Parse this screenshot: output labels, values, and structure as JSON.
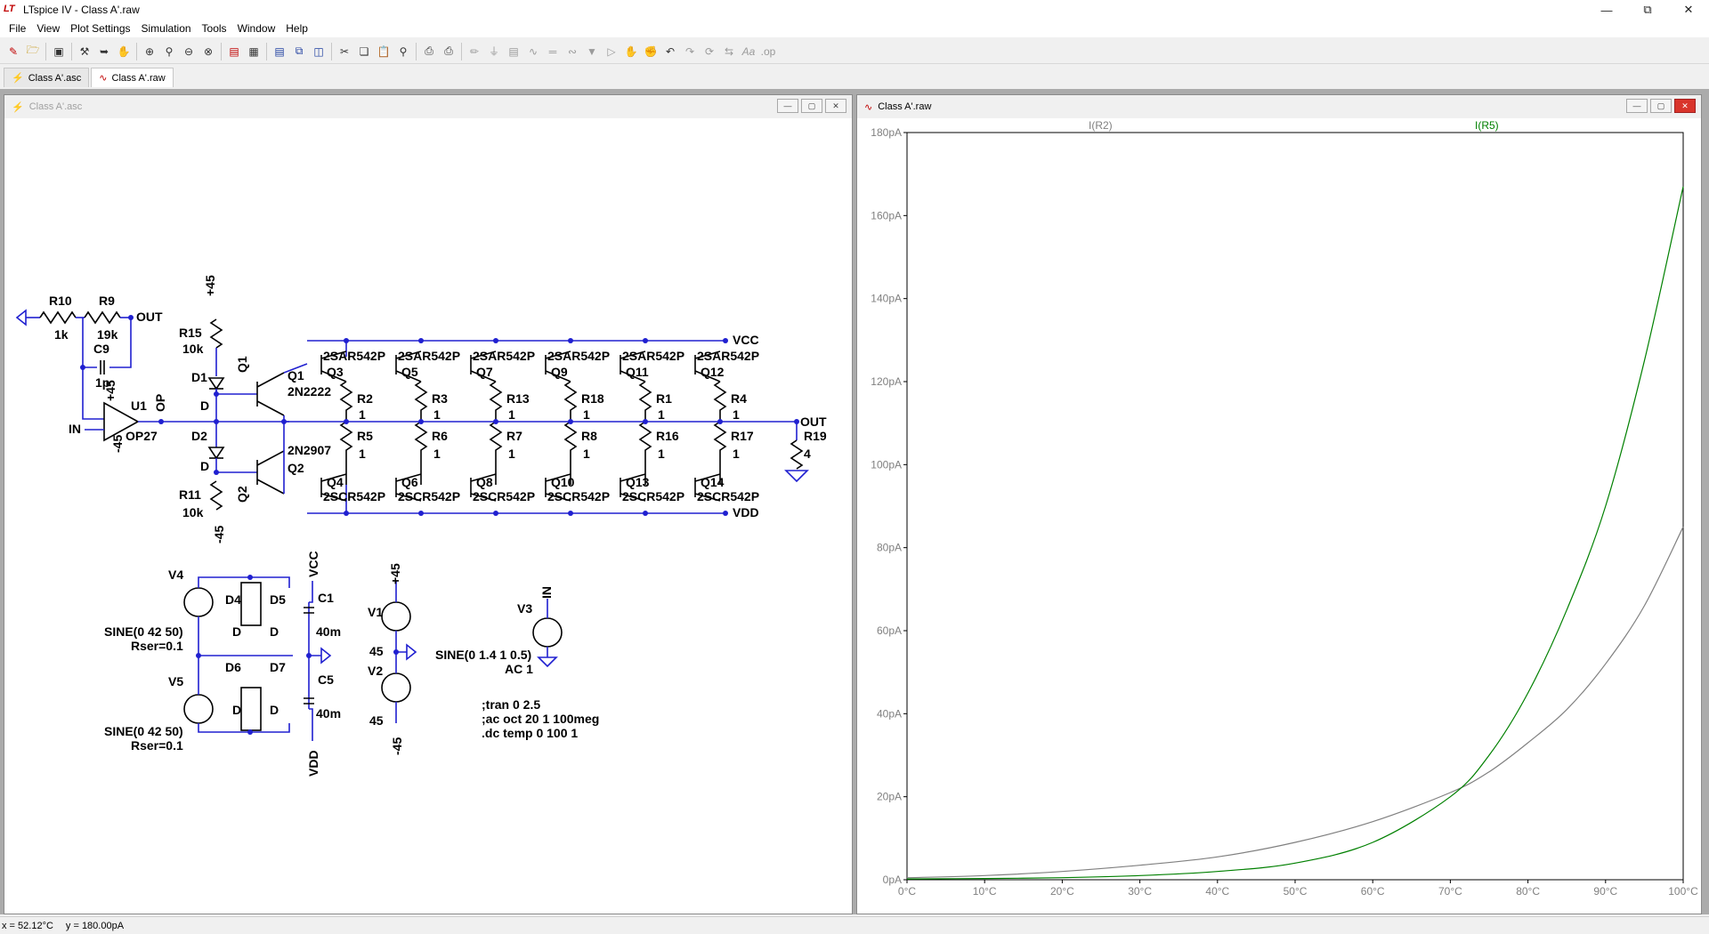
{
  "window": {
    "title": "LTspice IV - Class A'.raw",
    "app_icon": "ltspice-logo-icon"
  },
  "menu": [
    "File",
    "View",
    "Plot Settings",
    "Simulation",
    "Tools",
    "Window",
    "Help"
  ],
  "doc_tabs": [
    {
      "label": "Class A'.asc",
      "icon": "schematic-icon",
      "active": false
    },
    {
      "label": "Class A'.raw",
      "icon": "waveform-icon",
      "active": true
    }
  ],
  "schematic_window": {
    "title": "Class A'.asc",
    "labels": {
      "R10": "R10",
      "R10v": "1k",
      "R9": "R9",
      "R9v": "19k",
      "C9": "C9",
      "C9v": "1p",
      "OUT": "OUT",
      "IN": "IN",
      "U1": "U1",
      "OP": "OP",
      "OP27": "OP27",
      "p45": "+45",
      "m45": "-45",
      "R15": "R15",
      "R15v": "10k",
      "R11": "R11",
      "R11v": "10k",
      "D1": "D1",
      "D2": "D2",
      "D": "D",
      "Q1": "Q1",
      "Q2": "Q2",
      "Q1m": "2N2222",
      "Q2m": "2N2907",
      "VCC": "VCC",
      "VDD": "VDD",
      "upper_q": [
        "Q3",
        "Q5",
        "Q7",
        "Q9",
        "Q11",
        "Q12"
      ],
      "lower_q": [
        "Q4",
        "Q6",
        "Q8",
        "Q10",
        "Q13",
        "Q14"
      ],
      "pnp_model": "2SAR542P",
      "npn_model": "2SCR542P",
      "upper_r": [
        "R2",
        "R3",
        "R13",
        "R18",
        "R1",
        "R4"
      ],
      "lower_r": [
        "R5",
        "R6",
        "R7",
        "R8",
        "R16",
        "R17"
      ],
      "rval": "1",
      "R19": "R19",
      "R19v": "4",
      "V4": "V4",
      "V5": "V5",
      "D4": "D4",
      "D5": "D5",
      "D6": "D6",
      "D7": "D7",
      "C1": "C1",
      "C5": "C5",
      "cval": "40m",
      "sine42": "SINE(0 42 50)",
      "rser": "Rser=0.1",
      "V1": "V1",
      "V2": "V2",
      "v45": "45",
      "V3": "V3",
      "sine14": "SINE(0 1.4 1 0.5)",
      "ac1": "AC 1",
      "d1": ";tran 0 2.5",
      "d2": ";ac oct 20 1 100meg",
      "d3": ".dc temp 0 100 1"
    }
  },
  "plot_window": {
    "title": "Class A'.raw",
    "traces": [
      {
        "name": "I(R2)",
        "color": "#808080"
      },
      {
        "name": "I(R5)",
        "color": "#008000"
      }
    ]
  },
  "chart_data": {
    "type": "line",
    "xlabel": "",
    "ylabel": "",
    "xlim": [
      0,
      100
    ],
    "ylim": [
      0,
      180
    ],
    "x_ticks": [
      "0°C",
      "10°C",
      "20°C",
      "30°C",
      "40°C",
      "50°C",
      "60°C",
      "70°C",
      "80°C",
      "90°C",
      "100°C"
    ],
    "y_ticks": [
      "0pA",
      "20pA",
      "40pA",
      "60pA",
      "80pA",
      "100pA",
      "120pA",
      "140pA",
      "160pA",
      "180pA"
    ],
    "x": [
      0,
      10,
      20,
      30,
      40,
      50,
      60,
      70,
      75,
      80,
      85,
      90,
      95,
      100
    ],
    "series": [
      {
        "name": "I(R2)",
        "color": "#808080",
        "values": [
          0.5,
          1.0,
          2.0,
          3.5,
          5.5,
          9.0,
          14.0,
          21.0,
          26.0,
          33.0,
          41.0,
          52.0,
          66.0,
          85.0
        ]
      },
      {
        "name": "I(R5)",
        "color": "#008000",
        "values": [
          0.2,
          0.3,
          0.5,
          1.0,
          2.0,
          4.0,
          9.0,
          20.0,
          30.0,
          45.0,
          65.0,
          90.0,
          125.0,
          167.0
        ]
      }
    ],
    "grid": false
  },
  "status": {
    "x": "x = 52.12°C",
    "y": "y = 180.00pA"
  },
  "toolbar_icons": [
    "new-schematic-icon",
    "open-icon",
    "save-icon",
    "control-panel-icon",
    "run-icon",
    "halt-icon",
    "zoom-in-icon",
    "zoom-full-icon",
    "zoom-out-icon",
    "zoom-cancel-icon",
    "autorange-icon",
    "fit-icon",
    "tile-horizontal-icon",
    "cascade-icon",
    "tile-vertical-icon",
    "cut-icon",
    "copy-icon",
    "paste-icon",
    "find-icon",
    "print-icon",
    "print-preview-icon",
    "wire-icon",
    "ground-icon",
    "label-icon",
    "resistor-icon",
    "capacitor-icon",
    "inductor-icon",
    "diode-icon",
    "component-icon",
    "move-icon",
    "drag-icon",
    "undo-icon",
    "redo-icon",
    "rotate-icon",
    "mirror-icon",
    "text-icon",
    "spice-directive-icon"
  ]
}
